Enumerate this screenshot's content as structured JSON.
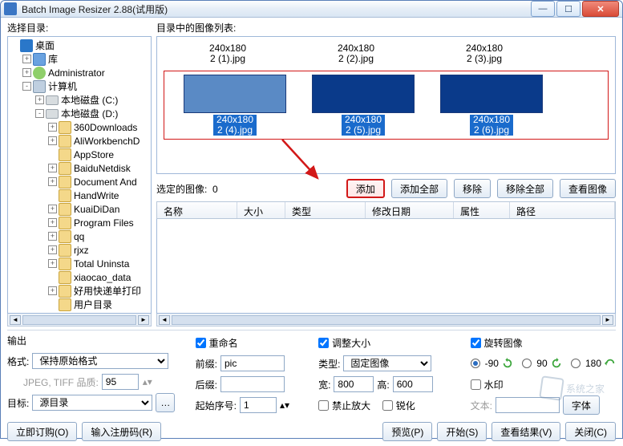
{
  "window": {
    "title": "Batch Image Resizer 2.88(试用版)"
  },
  "labels": {
    "select_dir": "选择目录:",
    "image_list": "目录中的图像列表:",
    "selected_images": "选定的图像:",
    "selected_count": "0",
    "output": "输出",
    "format": "格式:",
    "jpeg_quality": "JPEG, TIFF 品质:",
    "target": "目标:",
    "rename": "重命名",
    "prefix": "前缀:",
    "suffix": "后缀:",
    "start_index": "起始序号:",
    "resize": "调整大小",
    "type": "类型:",
    "width": "宽:",
    "height": "高:",
    "no_enlarge": "禁止放大",
    "sharpen": "锐化",
    "rotate": "旋转图像",
    "watermark": "水印",
    "wm_text": "文本:",
    "font_btn": "字体"
  },
  "tree": [
    {
      "indent": 0,
      "exp": "",
      "icon": "desktop",
      "label": "桌面"
    },
    {
      "indent": 1,
      "exp": "+",
      "icon": "lib",
      "label": "库"
    },
    {
      "indent": 1,
      "exp": "+",
      "icon": "user",
      "label": "Administrator"
    },
    {
      "indent": 1,
      "exp": "-",
      "icon": "computer",
      "label": "计算机"
    },
    {
      "indent": 2,
      "exp": "+",
      "icon": "drive",
      "label": "本地磁盘 (C:)"
    },
    {
      "indent": 2,
      "exp": "-",
      "icon": "drive",
      "label": "本地磁盘 (D:)"
    },
    {
      "indent": 3,
      "exp": "+",
      "icon": "folder",
      "label": "360Downloads"
    },
    {
      "indent": 3,
      "exp": "+",
      "icon": "folder",
      "label": "AliWorkbenchD"
    },
    {
      "indent": 3,
      "exp": "",
      "icon": "folder",
      "label": "AppStore"
    },
    {
      "indent": 3,
      "exp": "+",
      "icon": "folder",
      "label": "BaiduNetdisk"
    },
    {
      "indent": 3,
      "exp": "+",
      "icon": "folder",
      "label": "Document And"
    },
    {
      "indent": 3,
      "exp": "",
      "icon": "folder",
      "label": "HandWrite"
    },
    {
      "indent": 3,
      "exp": "+",
      "icon": "folder",
      "label": "KuaiDiDan"
    },
    {
      "indent": 3,
      "exp": "+",
      "icon": "folder",
      "label": "Program Files"
    },
    {
      "indent": 3,
      "exp": "+",
      "icon": "folder",
      "label": "qq"
    },
    {
      "indent": 3,
      "exp": "+",
      "icon": "folder",
      "label": "rjxz"
    },
    {
      "indent": 3,
      "exp": "+",
      "icon": "folder",
      "label": "Total Uninsta"
    },
    {
      "indent": 3,
      "exp": "",
      "icon": "folder",
      "label": "xiaocao_data"
    },
    {
      "indent": 3,
      "exp": "+",
      "icon": "folder",
      "label": "好用快递单打印"
    },
    {
      "indent": 3,
      "exp": "",
      "icon": "folder",
      "label": "用户目录"
    }
  ],
  "thumbs": {
    "row1": [
      {
        "dim": "240x180",
        "name": "2 (1).jpg"
      },
      {
        "dim": "240x180",
        "name": "2 (2).jpg"
      },
      {
        "dim": "240x180",
        "name": "2 (3).jpg"
      }
    ],
    "row2": [
      {
        "dim": "240x180",
        "name": "2 (4).jpg",
        "light": true
      },
      {
        "dim": "240x180",
        "name": "2 (5).jpg"
      },
      {
        "dim": "240x180",
        "name": "2 (6).jpg"
      }
    ]
  },
  "toolbar": {
    "add": "添加",
    "add_all": "添加全部",
    "remove": "移除",
    "remove_all": "移除全部",
    "view": "查看图像"
  },
  "columns": {
    "name": "名称",
    "size": "大小",
    "type": "类型",
    "modified": "修改日期",
    "attr": "属性",
    "path": "路径"
  },
  "output": {
    "format_value": "保持原始格式",
    "quality_value": "95",
    "target_value": "源目录"
  },
  "rename": {
    "prefix_value": "pic",
    "suffix_value": "",
    "start_value": "1"
  },
  "resize": {
    "type_value": "固定图像",
    "width_value": "800",
    "height_value": "600"
  },
  "rotate": {
    "opt_neg90": "-90",
    "opt_90": "90",
    "opt_180": "180"
  },
  "footer": {
    "order": "立即订购(O)",
    "register": "输入注册码(R)",
    "preview": "预览(P)",
    "start": "开始(S)",
    "results": "查看结果(V)",
    "close": "关闭(C)"
  },
  "watermark_site": "系统之家"
}
